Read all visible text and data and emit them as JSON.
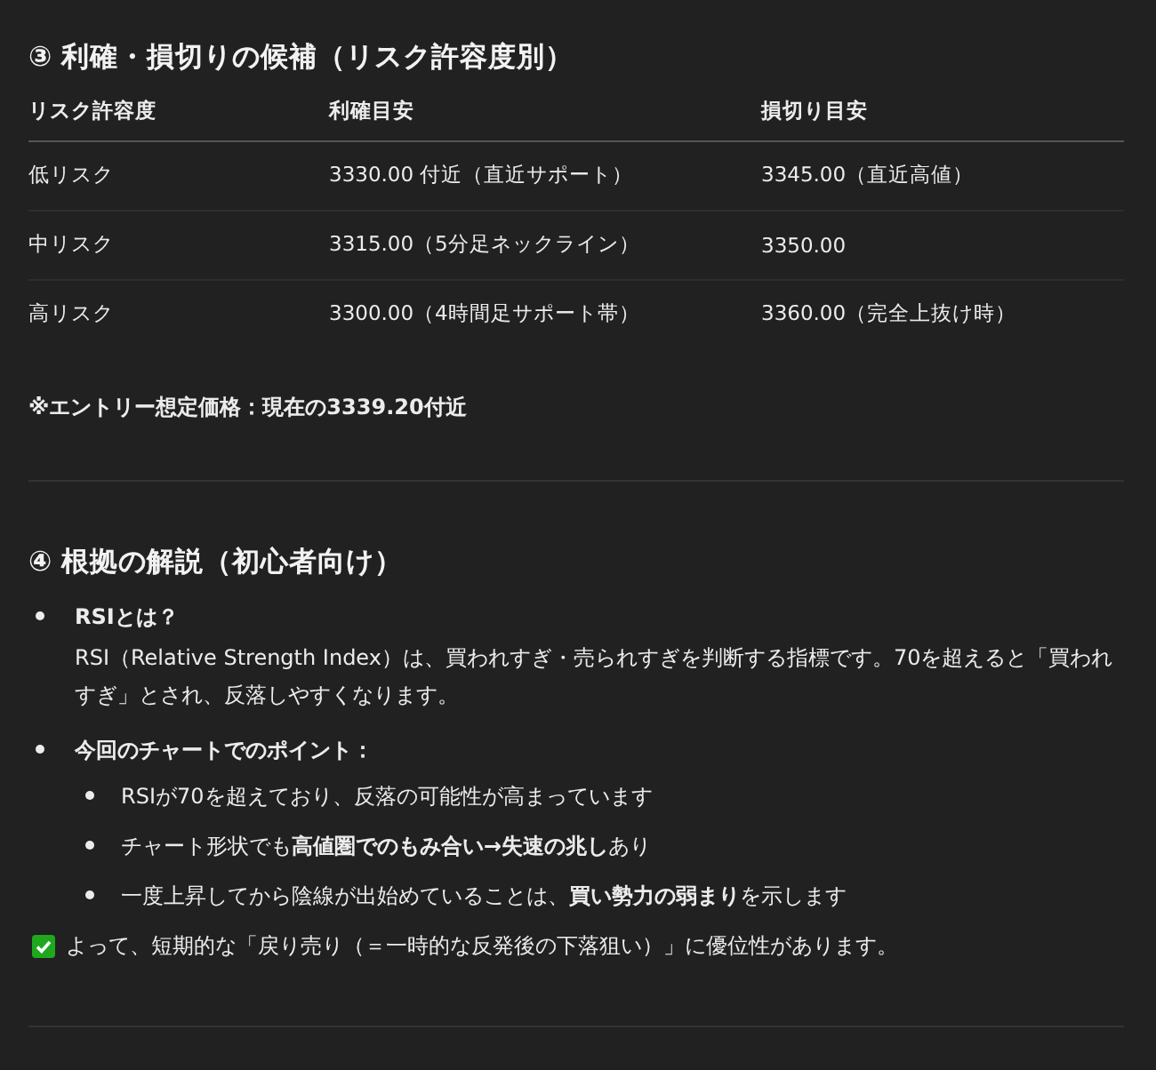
{
  "risk_section": {
    "heading": "③ 利確・損切りの候補（リスク許容度別）",
    "table": {
      "columns": [
        "リスク許容度",
        "利確目安",
        "損切り目安"
      ],
      "rows": [
        [
          "低リスク",
          "3330.00 付近（直近サポート）",
          "3345.00（直近高値）"
        ],
        [
          "中リスク",
          "3315.00（5分足ネックライン）",
          "3350.00"
        ],
        [
          "高リスク",
          "3300.00（4時間足サポート帯）",
          "3360.00（完全上抜け時）"
        ]
      ]
    },
    "note": "※エントリー想定価格：現在の3339.20付近"
  },
  "reason_section": {
    "heading": "④ 根拠の解説（初心者向け）",
    "bullets": [
      {
        "title": "RSIとは？",
        "body": "RSI（Relative Strength Index）は、買われすぎ・売られすぎを判断する指標です。70を超えると「買われすぎ」とされ、反落しやすくなります。"
      },
      {
        "title": "今回のチャートでのポイント：",
        "children": [
          "RSIが70を超えており、反落の可能性が高まっています",
          "チャート形状でも**高値圏でのもみ合い→失速の兆し**あり",
          "一度上昇してから陰線が出始めていることは、**買い勢力の弱まり**を示します"
        ]
      }
    ],
    "conclusion": {
      "checked": true,
      "text": "よって、短期的な「戻り売り（＝一時的な反発後の下落狙い）」に優位性があります。"
    }
  }
}
